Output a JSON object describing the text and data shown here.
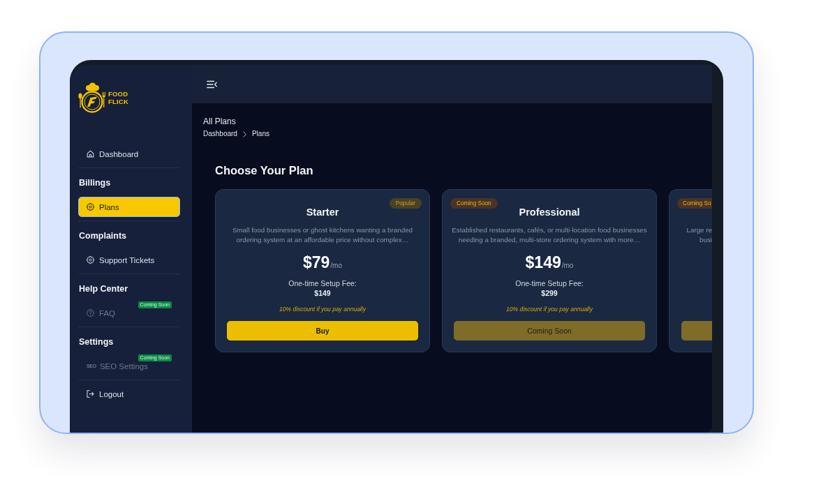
{
  "sidebar": {
    "logo": {
      "lines": [
        "FOOD",
        "FLICK"
      ]
    },
    "sections": [
      {
        "items": [
          {
            "label": "Dashboard",
            "selected": false,
            "disabled": false
          }
        ]
      },
      {
        "title": "Billings",
        "items": [
          {
            "label": "Plans",
            "selected": true,
            "disabled": false
          }
        ]
      },
      {
        "title": "Complaints",
        "items": [
          {
            "label": "Support Tickets",
            "selected": false,
            "disabled": false
          }
        ]
      },
      {
        "title": "Help Center",
        "items": [
          {
            "label": "FAQ",
            "selected": false,
            "disabled": true,
            "badge": "Coming Soon"
          }
        ]
      },
      {
        "title": "Settings",
        "items": [
          {
            "label": "SEO Settings",
            "icon_text": "SEO",
            "selected": false,
            "disabled": true,
            "badge": "Coming Soon"
          }
        ]
      },
      {
        "items": [
          {
            "label": "Logout",
            "selected": false,
            "disabled": false
          }
        ]
      }
    ]
  },
  "page": {
    "title": "All Plans",
    "breadcrumb": [
      "Dashboard",
      "Plans"
    ]
  },
  "plans": {
    "heading": "Choose Your Plan",
    "cards": [
      {
        "kind": "full",
        "badge": {
          "text": "Popular",
          "kind": "popular"
        },
        "name": "Starter",
        "description": [
          "Small food businesses or ghost kitchens wanting a branded",
          "ordering system at an affordable price without complex…"
        ],
        "price": "$79",
        "period": "/mo",
        "setup_label": "One-time Setup Fee:",
        "setup_fee": "$149",
        "note": "10% discount if you pay annually",
        "button": {
          "label": "Buy",
          "enabled": true
        }
      },
      {
        "kind": "full",
        "badge": {
          "text": "Coming Soon",
          "kind": "coming_soon"
        },
        "name": "Professional",
        "description": [
          "Established restaurants, cafés, or multi-location food businesses",
          "needing a branded, multi-store ordering system with more…"
        ],
        "price": "$149",
        "period": "/mo",
        "setup_label": "One-time Setup Fee:",
        "setup_fee": "$299",
        "note": "10% discount if you pay annually",
        "button": {
          "label": "Coming Soon",
          "enabled": false
        }
      },
      {
        "kind": "clipped",
        "badge": {
          "text": "Coming So",
          "kind": "coming_soon"
        },
        "description": [
          "Large re",
          "busi"
        ],
        "button": {
          "enabled": false
        }
      }
    ]
  }
}
